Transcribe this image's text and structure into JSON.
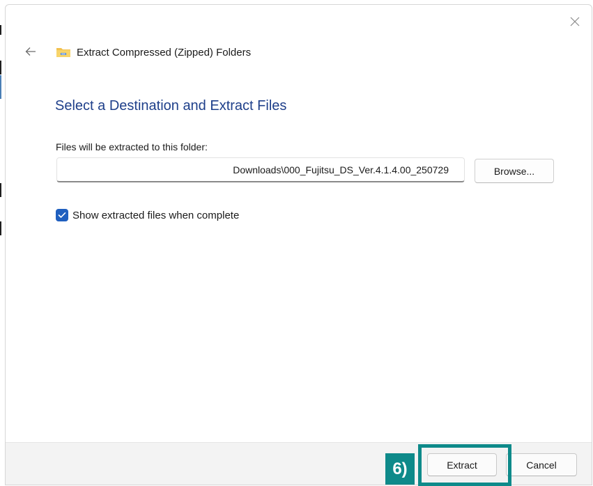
{
  "dialog": {
    "window_title": "Extract Compressed (Zipped) Folders",
    "heading": "Select a Destination and Extract Files",
    "destination_label": "Files will be extracted to this folder:",
    "destination_value": "Downloads\\000_Fujitsu_DS_Ver.4.1.4.00_250729",
    "browse_label": "Browse...",
    "show_files_label": "Show extracted files when complete",
    "show_files_checked": true,
    "extract_label": "Extract",
    "cancel_label": "Cancel"
  },
  "annotation": {
    "step_label": "6)",
    "color": "#0e8a8a"
  },
  "icons": {
    "close": "close-icon",
    "back": "back-arrow-icon",
    "folder": "zip-folder-icon",
    "check": "checkmark-icon"
  },
  "colors": {
    "heading": "#1e3f8a",
    "checkbox": "#1f5fbf",
    "footer": "#f3f3f3"
  }
}
